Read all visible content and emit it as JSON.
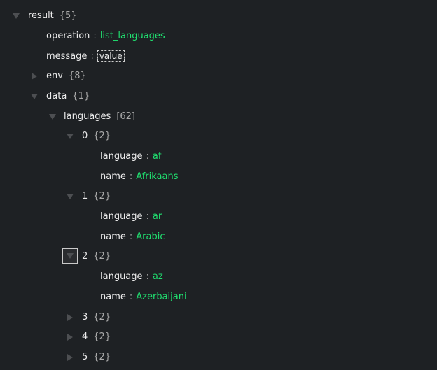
{
  "tree": [
    {
      "level": 0,
      "key": "result",
      "count": "{5}",
      "state": "down"
    },
    {
      "level": 1,
      "key": "operation",
      "value": "list_languages"
    },
    {
      "level": 1,
      "key": "message",
      "placeholder": "value"
    },
    {
      "level": 1,
      "key": "env",
      "count": "{8}",
      "state": "right"
    },
    {
      "level": 1,
      "key": "data",
      "count": "{1}",
      "state": "down"
    },
    {
      "level": 2,
      "key": "languages",
      "count": "[62]",
      "state": "down"
    },
    {
      "level": 3,
      "key": "0",
      "count": "{2}",
      "state": "down"
    },
    {
      "level": 4,
      "key": "language",
      "value": "af"
    },
    {
      "level": 4,
      "key": "name",
      "value": "Afrikaans"
    },
    {
      "level": 3,
      "key": "1",
      "count": "{2}",
      "state": "down"
    },
    {
      "level": 4,
      "key": "language",
      "value": "ar"
    },
    {
      "level": 4,
      "key": "name",
      "value": "Arabic"
    },
    {
      "level": 3,
      "key": "2",
      "count": "{2}",
      "state": "down",
      "focused": true
    },
    {
      "level": 4,
      "key": "language",
      "value": "az"
    },
    {
      "level": 4,
      "key": "name",
      "value": "Azerbaijani"
    },
    {
      "level": 3,
      "key": "3",
      "count": "{2}",
      "state": "right"
    },
    {
      "level": 3,
      "key": "4",
      "count": "{2}",
      "state": "right"
    },
    {
      "level": 3,
      "key": "5",
      "count": "{2}",
      "state": "right"
    }
  ],
  "colors": {
    "background": "#1e2124",
    "value": "#20e070"
  }
}
